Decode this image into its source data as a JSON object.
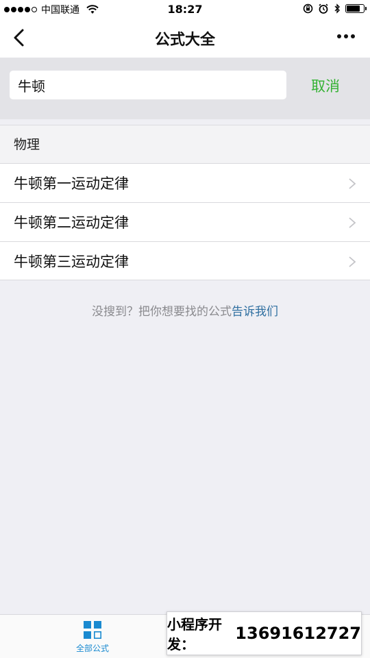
{
  "status_bar": {
    "carrier": "中国联通",
    "time": "18:27",
    "battery_level": 0.8
  },
  "nav": {
    "title": "公式大全",
    "back_icon": "chevron-left-icon",
    "more_icon": "more-dots-icon"
  },
  "search": {
    "value": "牛顿",
    "cancel_label": "取消"
  },
  "section": {
    "title": "物理",
    "items": [
      {
        "label": "牛顿第一运动定律"
      },
      {
        "label": "牛顿第二运动定律"
      },
      {
        "label": "牛顿第三运动定律"
      }
    ]
  },
  "hint": {
    "text": "没搜到？把你想要找的公式",
    "link": "告诉我们"
  },
  "tab_bar": {
    "items": [
      {
        "label": "全部公式",
        "icon": "grid-icon",
        "active": true
      }
    ]
  },
  "promo": {
    "label": "小程序开发：",
    "phone": "13691612727"
  },
  "colors": {
    "accent_green": "#34b233",
    "link_blue": "#2f6fa0",
    "tab_active": "#1a8ad0"
  }
}
